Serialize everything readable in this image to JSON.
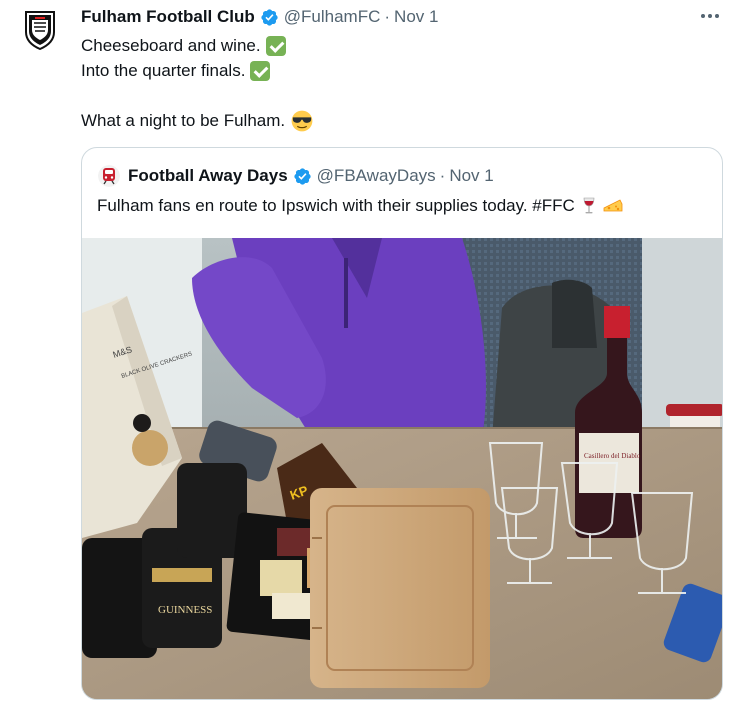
{
  "tweet": {
    "display_name": "Fulham Football Club",
    "handle": "@FulhamFC",
    "separator": "·",
    "date": "Nov 1",
    "lines": [
      "Cheeseboard and wine.",
      "Into the quarter finals.",
      "",
      "What a night to be Fulham."
    ],
    "icons": {
      "avatar": "fulham-crest-icon",
      "verified": "verified-badge-icon",
      "more": "more-options-icon",
      "check": "check-mark-icon",
      "sunglasses": "sunglasses-emoji-icon"
    }
  },
  "quote": {
    "display_name": "Football Away Days",
    "handle": "@FBAwayDays",
    "separator": "·",
    "date": "Nov 1",
    "text": "Fulham fans en route to Ipswich with their supplies today. #FFC",
    "icons": {
      "avatar": "train-avatar-icon",
      "verified": "verified-badge-icon",
      "wine": "wine-glass-emoji-icon",
      "cheese": "cheese-emoji-icon"
    },
    "photo_items": {
      "tube_label": "M&S",
      "tube_text": "BLACK OLIVE CRACKERS",
      "crisps_label": "KP",
      "can_label": "GUINNESS",
      "bottle_label": "Casillero del Diablo"
    }
  },
  "colors": {
    "text_primary": "#0f1419",
    "text_secondary": "#536471",
    "verified_blue": "#1d9bf0",
    "check_green": "#77b255",
    "card_border": "#cfd9de"
  }
}
